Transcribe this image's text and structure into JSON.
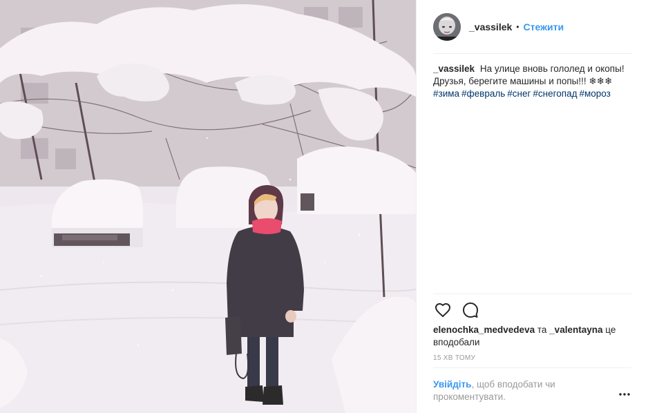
{
  "header": {
    "username": "_vassilek",
    "separator": "•",
    "follow_label": "Стежити"
  },
  "caption": {
    "author": "_vassilek",
    "text": "На улице вновь гололед и окопы! Друзья, берегите машины и попы!!! ❄❄❄",
    "hashtags": [
      "#зима",
      "#февраль",
      "#снег",
      "#снегопад",
      "#мороз"
    ]
  },
  "actions": {
    "like_icon": "heart-icon",
    "comment_icon": "comment-icon"
  },
  "likes": {
    "user1": "elenochka_medvedeva",
    "connector": "та",
    "user2": "_valentayna",
    "suffix": "це вподобали"
  },
  "timestamp": "15 хв тому",
  "login_prompt": {
    "link_label": "Увійдіть",
    "text": ", щоб вподобати чи прокоментувати."
  },
  "more_icon": "more-options-icon",
  "colors": {
    "accent_blue": "#3897f0",
    "hashtag_blue": "#003569",
    "muted_gray": "#999999",
    "divider": "#efefef"
  }
}
